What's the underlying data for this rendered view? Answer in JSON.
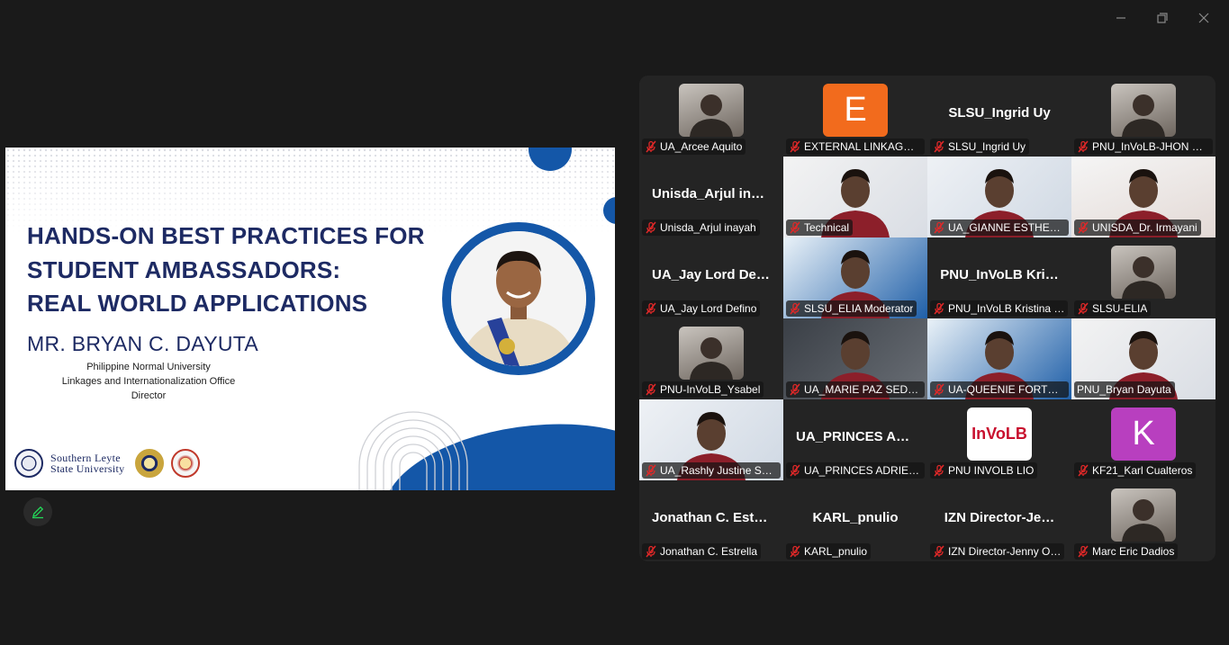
{
  "slide": {
    "title_lines": [
      "HANDS-ON BEST PRACTICES FOR",
      "STUDENT AMBASSADORS:",
      "REAL WORLD APPLICATIONS"
    ],
    "speaker": "MR. BRYAN C. DAYUTA",
    "affiliation": [
      "Philippine Normal University",
      "Linkages and Internationalization Office",
      "Director"
    ],
    "logo_text": [
      "Southern Leyte",
      "State University"
    ]
  },
  "colors": {
    "slide_navy": "#1d2a63",
    "slide_blue": "#1457a8",
    "speaking_outline": "#23d959",
    "muted_red": "#e02828"
  },
  "participants": [
    {
      "label": "UA_Arcee Aquito",
      "kind": "photo"
    },
    {
      "label": "EXTERNAL LINKAGES…",
      "kind": "letter",
      "letter": "E",
      "color": "#f26b1d"
    },
    {
      "label": "SLSU_Ingrid Uy",
      "kind": "name",
      "big": "SLSU_Ingrid Uy"
    },
    {
      "label": "PNU_InVoLB-JHON M…",
      "kind": "photo"
    },
    {
      "label": "Unisda_Arjul inayah",
      "kind": "name",
      "big": "Unisda_Arjul  ina…"
    },
    {
      "label": "Technical",
      "kind": "video"
    },
    {
      "label": "UA_GIANNE ESTHER …",
      "kind": "video"
    },
    {
      "label": "UNISDA_Dr. Irmayani",
      "kind": "video"
    },
    {
      "label": "UA_Jay Lord Defino",
      "kind": "name",
      "big": "UA_Jay Lord Def…"
    },
    {
      "label": "SLSU_ELIA Moderator",
      "kind": "video"
    },
    {
      "label": "PNU_InVoLB Kristina …",
      "kind": "name",
      "big": "PNU_InVoLB  Kri…"
    },
    {
      "label": "SLSU-ELIA",
      "kind": "photo"
    },
    {
      "label": "PNU-InVoLB_Ysabel",
      "kind": "photo"
    },
    {
      "label": "UA_MARIE PAZ SEDU…",
      "kind": "video"
    },
    {
      "label": "UA-QUEENIE FORTU…",
      "kind": "video"
    },
    {
      "label": "PNU_Bryan Dayuta",
      "kind": "video",
      "speaking": true,
      "unmuted": true
    },
    {
      "label": "UA_Rashly Justine Sali…",
      "kind": "video"
    },
    {
      "label": "UA_PRINCES ADRIELL…",
      "kind": "name",
      "big": "UA_PRINCES  AD…"
    },
    {
      "label": "PNU INVOLB LIO",
      "kind": "logo",
      "logo": "InVoLB"
    },
    {
      "label": "KF21_Karl Cualteros",
      "kind": "letter",
      "letter": "K",
      "color": "#b83fbf"
    },
    {
      "label": "Jonathan C. Estrella",
      "kind": "name",
      "big": "Jonathan  C.  Estr…"
    },
    {
      "label": "KARL_pnulio",
      "kind": "name",
      "big": "KARL_pnulio"
    },
    {
      "label": "IZN Director-Jenny O…",
      "kind": "name",
      "big": "IZN  Director-Je…"
    },
    {
      "label": "Marc Eric Dadios",
      "kind": "photo"
    }
  ]
}
